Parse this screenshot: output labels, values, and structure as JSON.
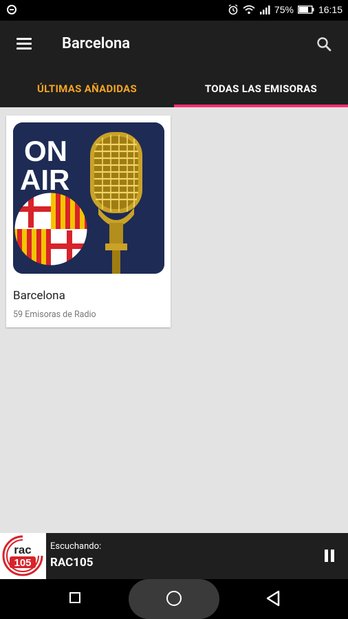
{
  "status_bar": {
    "battery": "75%",
    "time": "16:15"
  },
  "app_bar": {
    "title": "Barcelona"
  },
  "tabs": [
    {
      "label": "ÚLTIMAS AÑADIDAS",
      "active": true
    },
    {
      "label": "TODAS LAS EMISORAS",
      "active": false
    }
  ],
  "cards": [
    {
      "title": "Barcelona",
      "subtitle": "59 Emisoras de Radio",
      "image_text": [
        "ON",
        "AIR"
      ]
    }
  ],
  "player": {
    "label": "Escuchando:",
    "station": "RAC105",
    "logo_text": [
      "rac",
      "105"
    ]
  },
  "colors": {
    "accent": "#f5a623",
    "indicator": "#ff2d6f",
    "bar_bg": "#1f1f1f",
    "content_bg": "#e3e3e3",
    "brand_red": "#d8232a"
  }
}
